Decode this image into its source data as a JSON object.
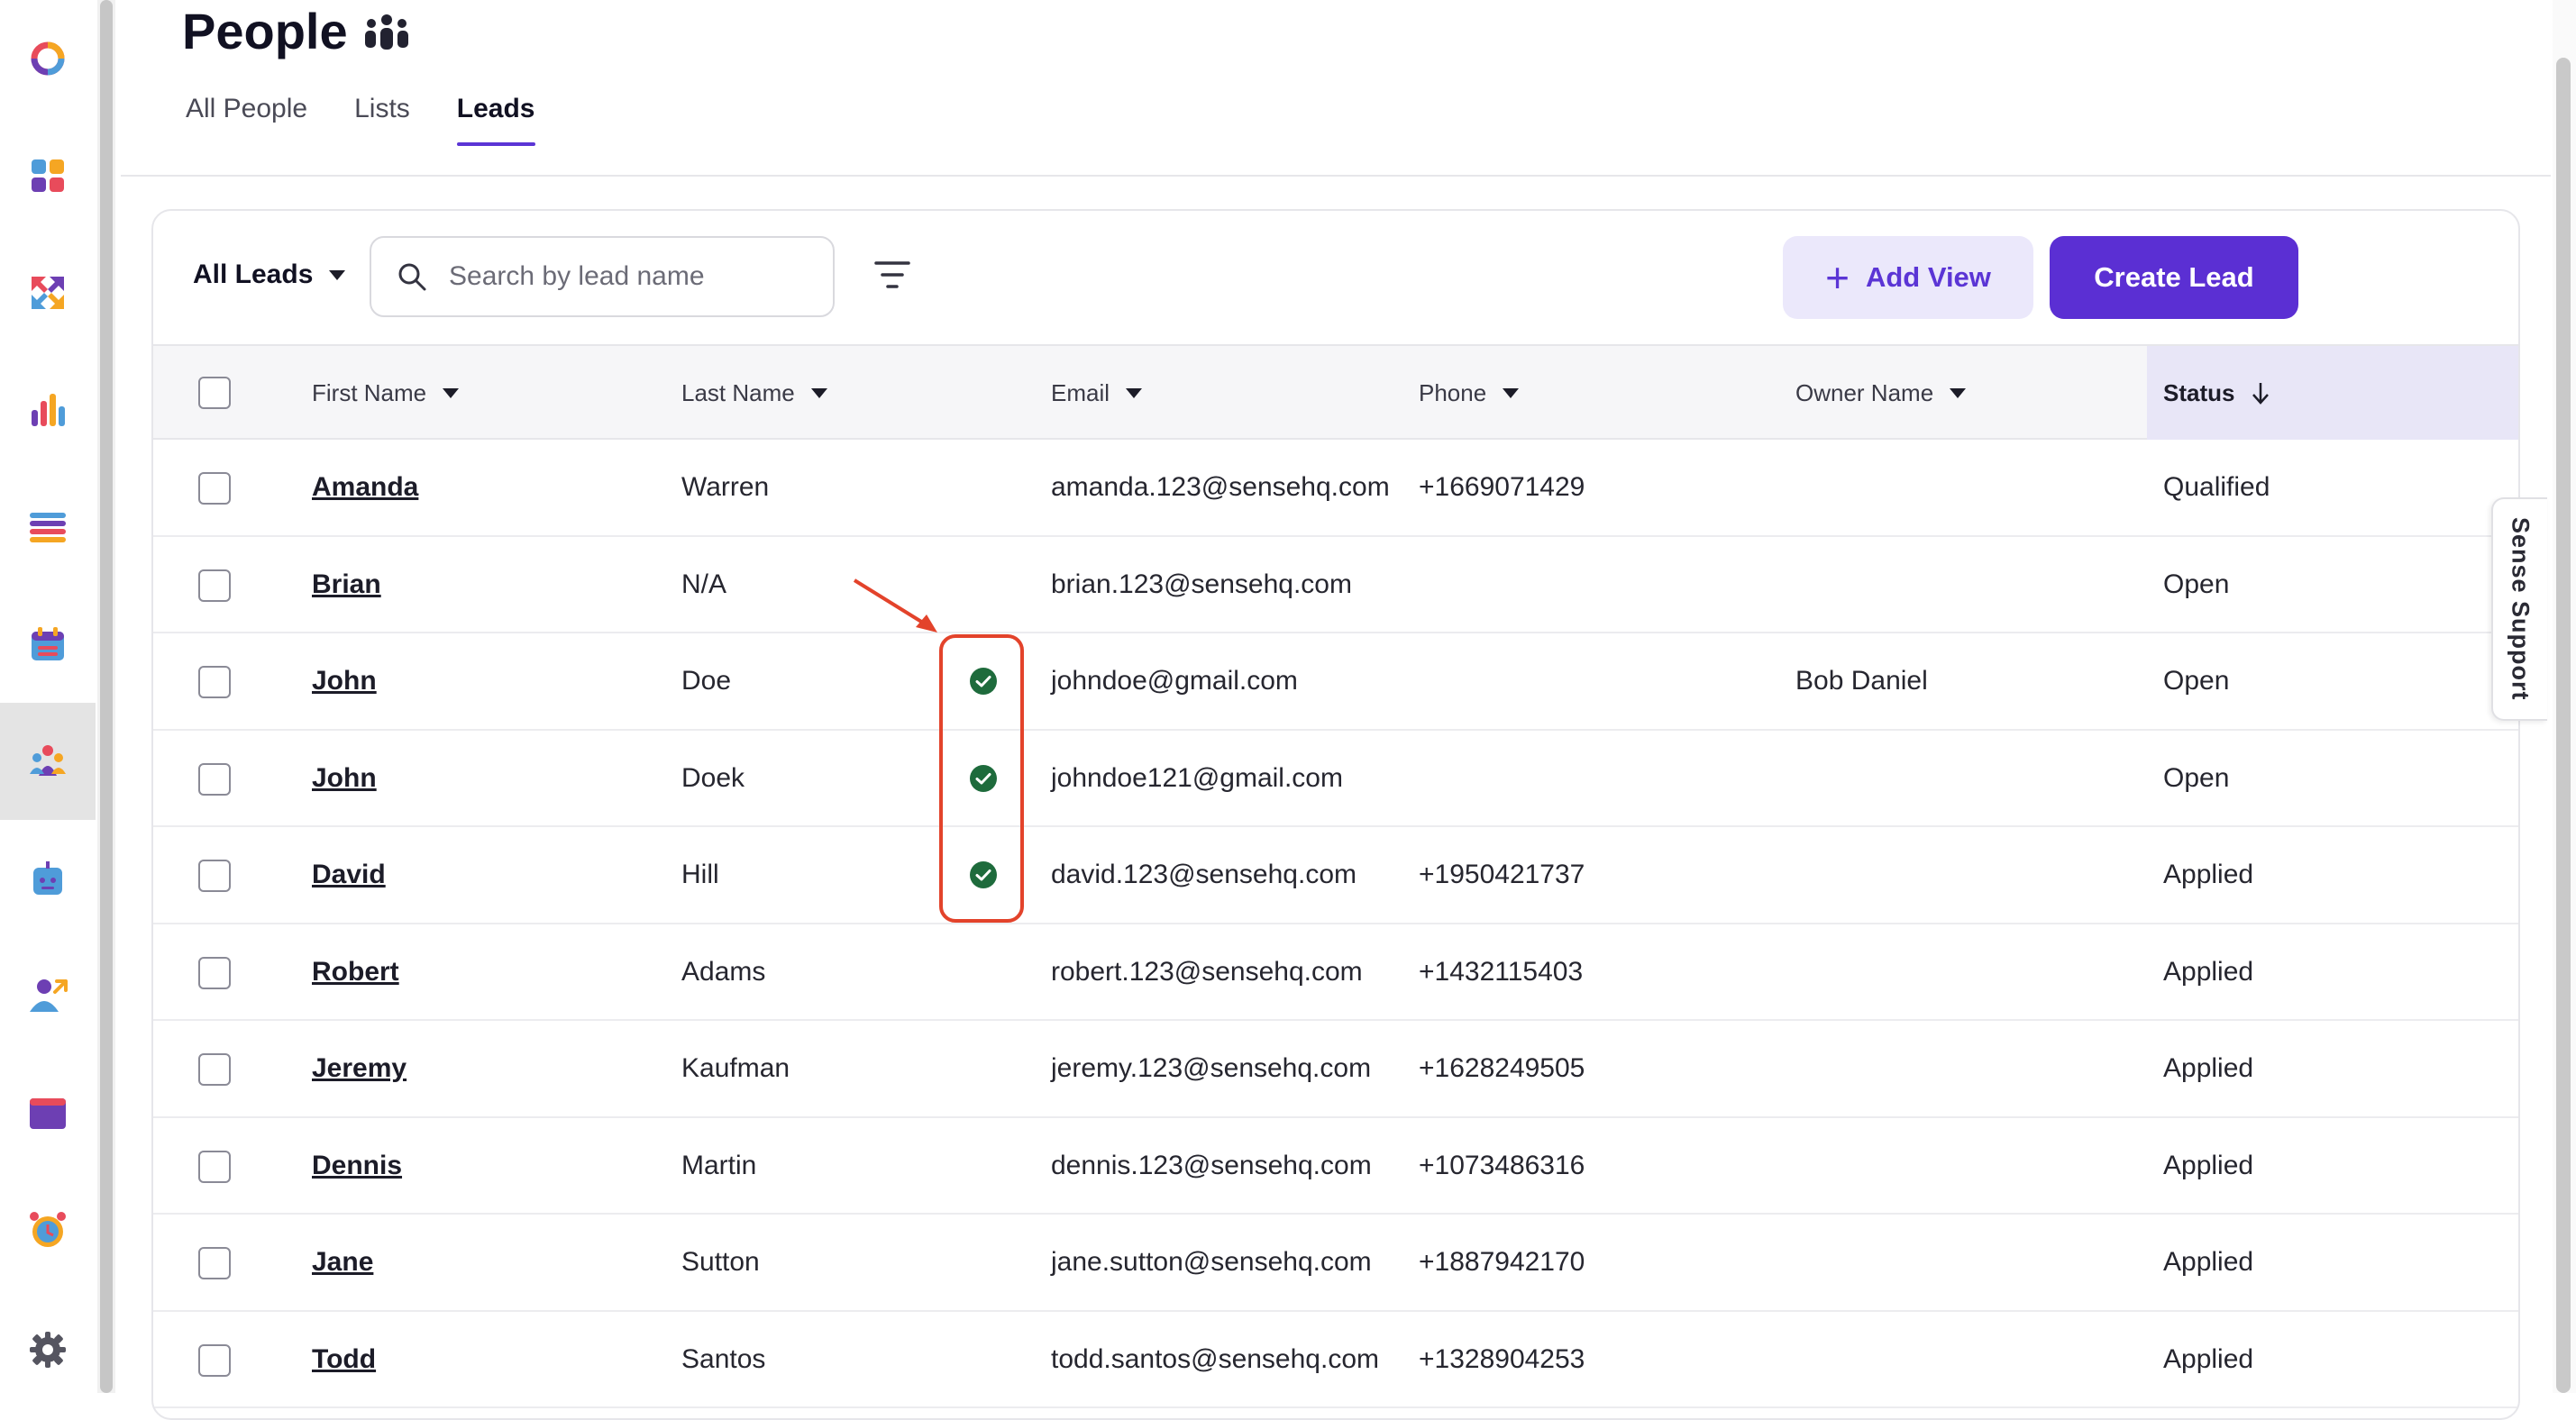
{
  "header": {
    "title": "People"
  },
  "tabs": [
    {
      "label": "All People",
      "active": false
    },
    {
      "label": "Lists",
      "active": false
    },
    {
      "label": "Leads",
      "active": true
    }
  ],
  "toolbar": {
    "view_selector": "All Leads",
    "search_placeholder": "Search by lead name",
    "add_view_label": "Add View",
    "create_label": "Create Lead"
  },
  "table": {
    "columns": [
      "First Name",
      "Last Name",
      "Email",
      "Phone",
      "Owner Name",
      "Status"
    ],
    "sorted_column": "Status",
    "rows": [
      {
        "first": "Amanda",
        "last": "Warren",
        "email": "amanda.123@sensehq.com",
        "phone": "+1669071429",
        "owner": "",
        "status": "Qualified",
        "verified": false
      },
      {
        "first": "Brian",
        "last": "N/A",
        "email": "brian.123@sensehq.com",
        "phone": "",
        "owner": "",
        "status": "Open",
        "verified": false
      },
      {
        "first": "John",
        "last": "Doe",
        "email": "johndoe@gmail.com",
        "phone": "",
        "owner": "Bob Daniel",
        "status": "Open",
        "verified": true
      },
      {
        "first": "John",
        "last": "Doek",
        "email": "johndoe121@gmail.com",
        "phone": "",
        "owner": "",
        "status": "Open",
        "verified": true
      },
      {
        "first": "David",
        "last": "Hill",
        "email": "david.123@sensehq.com",
        "phone": "+1950421737",
        "owner": "",
        "status": "Applied",
        "verified": true
      },
      {
        "first": "Robert",
        "last": "Adams",
        "email": "robert.123@sensehq.com",
        "phone": "+1432115403",
        "owner": "",
        "status": "Applied",
        "verified": false
      },
      {
        "first": "Jeremy",
        "last": "Kaufman",
        "email": "jeremy.123@sensehq.com",
        "phone": "+1628249505",
        "owner": "",
        "status": "Applied",
        "verified": false
      },
      {
        "first": "Dennis",
        "last": "Martin",
        "email": "dennis.123@sensehq.com",
        "phone": "+1073486316",
        "owner": "",
        "status": "Applied",
        "verified": false
      },
      {
        "first": "Jane",
        "last": "Sutton",
        "email": "jane.sutton@sensehq.com",
        "phone": "+1887942170",
        "owner": "",
        "status": "Applied",
        "verified": false
      },
      {
        "first": "Todd",
        "last": "Santos",
        "email": "todd.santos@sensehq.com",
        "phone": "+1328904253",
        "owner": "",
        "status": "Applied",
        "verified": false
      }
    ]
  },
  "support_tab": "Sense Support",
  "sidebar": {
    "icons": [
      "logo-icon",
      "dashboard-icon",
      "integrations-icon",
      "analytics-icon",
      "list-icon",
      "calendar-icon",
      "people-icon",
      "chatbot-icon",
      "referral-icon",
      "window-icon",
      "alarm-clock-icon",
      "settings-icon"
    ]
  },
  "colors": {
    "accent": "#5b2fd3",
    "verified": "#1e6b3c",
    "annotation": "#e3432b"
  }
}
